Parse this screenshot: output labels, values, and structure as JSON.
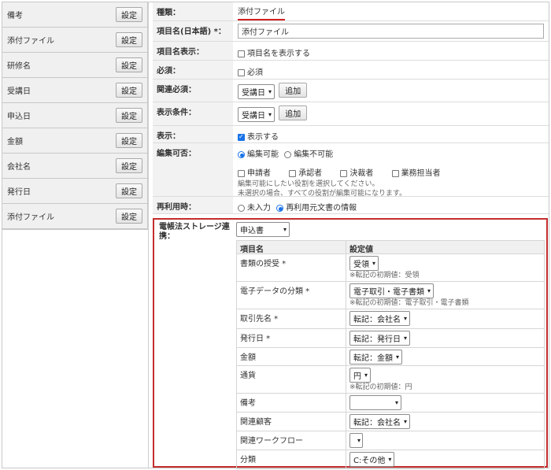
{
  "left_items": [
    {
      "label": "備考",
      "button": "設定"
    },
    {
      "label": "添付ファイル",
      "button": "設定"
    },
    {
      "label": "研修名",
      "button": "設定"
    },
    {
      "label": "受講日",
      "button": "設定"
    },
    {
      "label": "申込日",
      "button": "設定"
    },
    {
      "label": "金額",
      "button": "設定"
    },
    {
      "label": "会社名",
      "button": "設定"
    },
    {
      "label": "発行日",
      "button": "設定"
    },
    {
      "label": "添付ファイル",
      "button": "設定"
    }
  ],
  "form": {
    "type_label": "種類：",
    "type_value": "添付ファイル",
    "name_label": "項目名(日本語) *：",
    "name_value": "添付ファイル",
    "display_name_label": "項目名表示：",
    "display_name_option": "項目名を表示する",
    "required_label": "必須：",
    "required_option": "必須",
    "related_required_label": "関連必須：",
    "related_required_select": "受講日",
    "related_required_add": "追加",
    "display_cond_label": "表示条件：",
    "display_cond_select": "受講日",
    "display_cond_add": "追加",
    "show_label": "表示：",
    "show_option": "表示する",
    "editable_label": "編集可否：",
    "editable_yes": "編集可能",
    "editable_no": "編集不可能",
    "roles": [
      "申請者",
      "承認者",
      "決裁者",
      "業務担当者"
    ],
    "roles_note1": "編集可能にしたい役割を選択してください。",
    "roles_note2": "未選択の場合、すべての役割が編集可能になります。",
    "reuse_label": "再利用時：",
    "reuse_no": "未入力",
    "reuse_yes": "再利用元文書の情報"
  },
  "ebook": {
    "label": "電帳法ストレージ連携：",
    "select": "申込書",
    "col_name": "項目名",
    "col_value": "設定値",
    "rows": [
      {
        "name": "書類の授受 *",
        "value": "受領",
        "note": "※転記の初期値：受領"
      },
      {
        "name": "電子データの分類 *",
        "value": "電子取引・電子書類",
        "note": "※転記の初期値：電子取引・電子書類"
      },
      {
        "name": "取引先名 *",
        "value": "転記：会社名",
        "note": ""
      },
      {
        "name": "発行日 *",
        "value": "転記：発行日",
        "note": ""
      },
      {
        "name": "金額",
        "value": "転記：金額",
        "note": ""
      },
      {
        "name": "通貨",
        "value": "円",
        "note": "※転記の初期値：円"
      },
      {
        "name": "備考",
        "value": "",
        "note": ""
      },
      {
        "name": "関連顧客",
        "value": "転記：会社名",
        "note": ""
      },
      {
        "name": "関連ワークフロー",
        "value": "",
        "note": ""
      },
      {
        "name": "分類",
        "value": "C:その他",
        "note": ""
      }
    ]
  }
}
